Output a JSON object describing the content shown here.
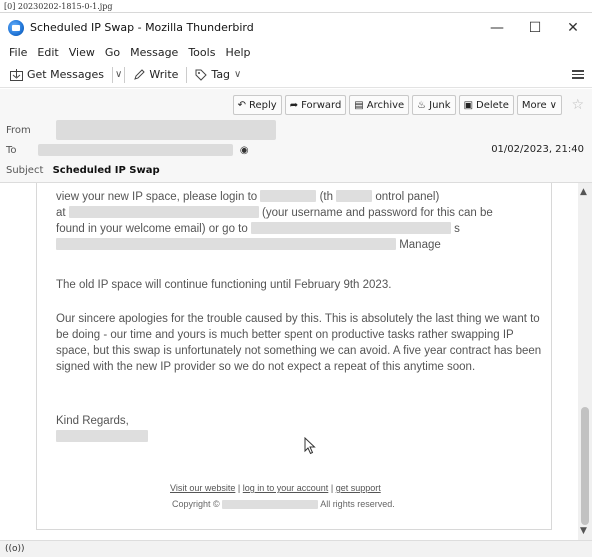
{
  "file_caption": "[0] 20230202-1815-0-1.jpg",
  "window": {
    "title": "Scheduled IP Swap - Mozilla Thunderbird",
    "minimize": "—",
    "maximize": "☐",
    "close": "✕"
  },
  "menu": [
    "File",
    "Edit",
    "View",
    "Go",
    "Message",
    "Tools",
    "Help"
  ],
  "toolbar": {
    "get_messages": "Get Messages",
    "write": "Write",
    "tag": "Tag"
  },
  "header": {
    "actions": {
      "reply": "Reply",
      "forward": "Forward",
      "archive": "Archive",
      "junk": "Junk",
      "delete": "Delete",
      "more": "More"
    },
    "from_label": "From",
    "to_label": "To",
    "subject_label": "Subject",
    "subject": "Scheduled IP Swap",
    "date": "01/02/2023, 21:40"
  },
  "body": {
    "line1a": "view your new IP space, please login to",
    "line1b": "(th",
    "line1c": "ontrol panel)",
    "line2a": "at",
    "line2b": "(your username and password for this can be",
    "line3a": "found in your welcome email) or go to",
    "line3b": "s",
    "line4": "Manage",
    "para2": "The old IP space will continue functioning until February 9th 2023.",
    "para3": "Our sincere apologies for the trouble caused by this. This is absolutely the last thing we want to be doing - our time and yours is much better spent on productive tasks rather swapping IP space, but this swap is unfortunately not something we can avoid. A five year contract has been signed with the new IP provider so we do not expect a repeat of this anytime soon.",
    "closing": "Kind Regards,",
    "footer": {
      "visit": "Visit our website",
      "login": "log in to your account",
      "support": "get support",
      "sep": "|",
      "copyright_prefix": "Copyright ©",
      "copyright_suffix": "All rights reserved."
    }
  },
  "status": {
    "connection": "((o))"
  }
}
